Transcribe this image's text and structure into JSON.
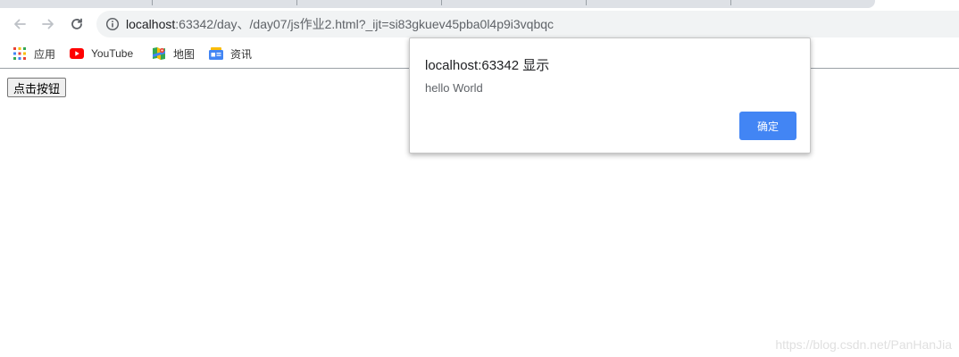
{
  "toolbar": {
    "back_icon": "arrow-left-icon",
    "forward_icon": "arrow-right-icon",
    "reload_icon": "reload-icon",
    "url_host": "localhost",
    "url_rest": ":63342/day、/day07/js作业2.html?_ijt=si83gkuev45pba0l4p9i3vqbqc"
  },
  "bookmarks": [
    {
      "label": "应用",
      "icon": "apps-grid-icon"
    },
    {
      "label": "YouTube",
      "icon": "youtube-icon"
    },
    {
      "label": "地图",
      "icon": "maps-icon"
    },
    {
      "label": "资讯",
      "icon": "news-icon"
    }
  ],
  "page": {
    "button_label": "点击按钮"
  },
  "dialog": {
    "title": "localhost:63342 显示",
    "message": "hello World",
    "ok_label": "确定",
    "ok_color": "#4285f4"
  },
  "watermark": "https://blog.csdn.net/PanHanJia"
}
